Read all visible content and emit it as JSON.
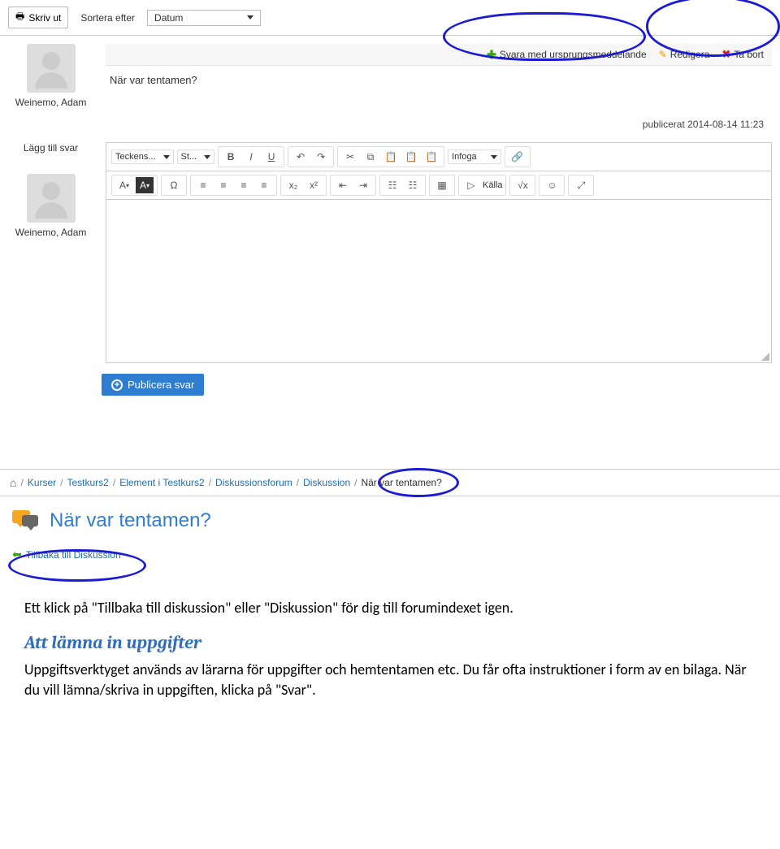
{
  "toolbar": {
    "print": "Skriv ut",
    "sort_label": "Sortera efter",
    "sort_value": "Datum"
  },
  "post": {
    "author": "Weinemo, Adam",
    "title": "När var tentamen?",
    "actions": {
      "reply_original": "Svara med ursprungsmeddelande",
      "edit": "Redigera",
      "delete": "Ta bort"
    },
    "meta": "publicerat 2014-08-14 11:23"
  },
  "reply": {
    "label": "Lägg till svar",
    "author": "Weinemo, Adam",
    "publish": "Publicera svar"
  },
  "editor": {
    "font": "Teckens...",
    "size": "St...",
    "insert": "Infoga",
    "source": "Källa"
  },
  "breadcrumb": {
    "items": [
      "Kurser",
      "Testkurs2",
      "Element i Testkurs2",
      "Diskussionsforum",
      "Diskussion"
    ],
    "current": "När var tentamen?"
  },
  "thread": {
    "title": "När var tentamen?",
    "back": "Tillbaka till Diskussion"
  },
  "doc": {
    "p1": "Ett klick på \"Tillbaka till diskussion\" eller \"Diskussion\" för dig till forumindexet igen.",
    "h2": "Att lämna in uppgifter",
    "p2": "Uppgiftsverktyget används av lärarna för uppgifter och hemtentamen etc. Du får ofta instruktioner i form av en bilaga. När du vill lämna/skriva  in uppgiften, klicka på \"Svar\"."
  }
}
